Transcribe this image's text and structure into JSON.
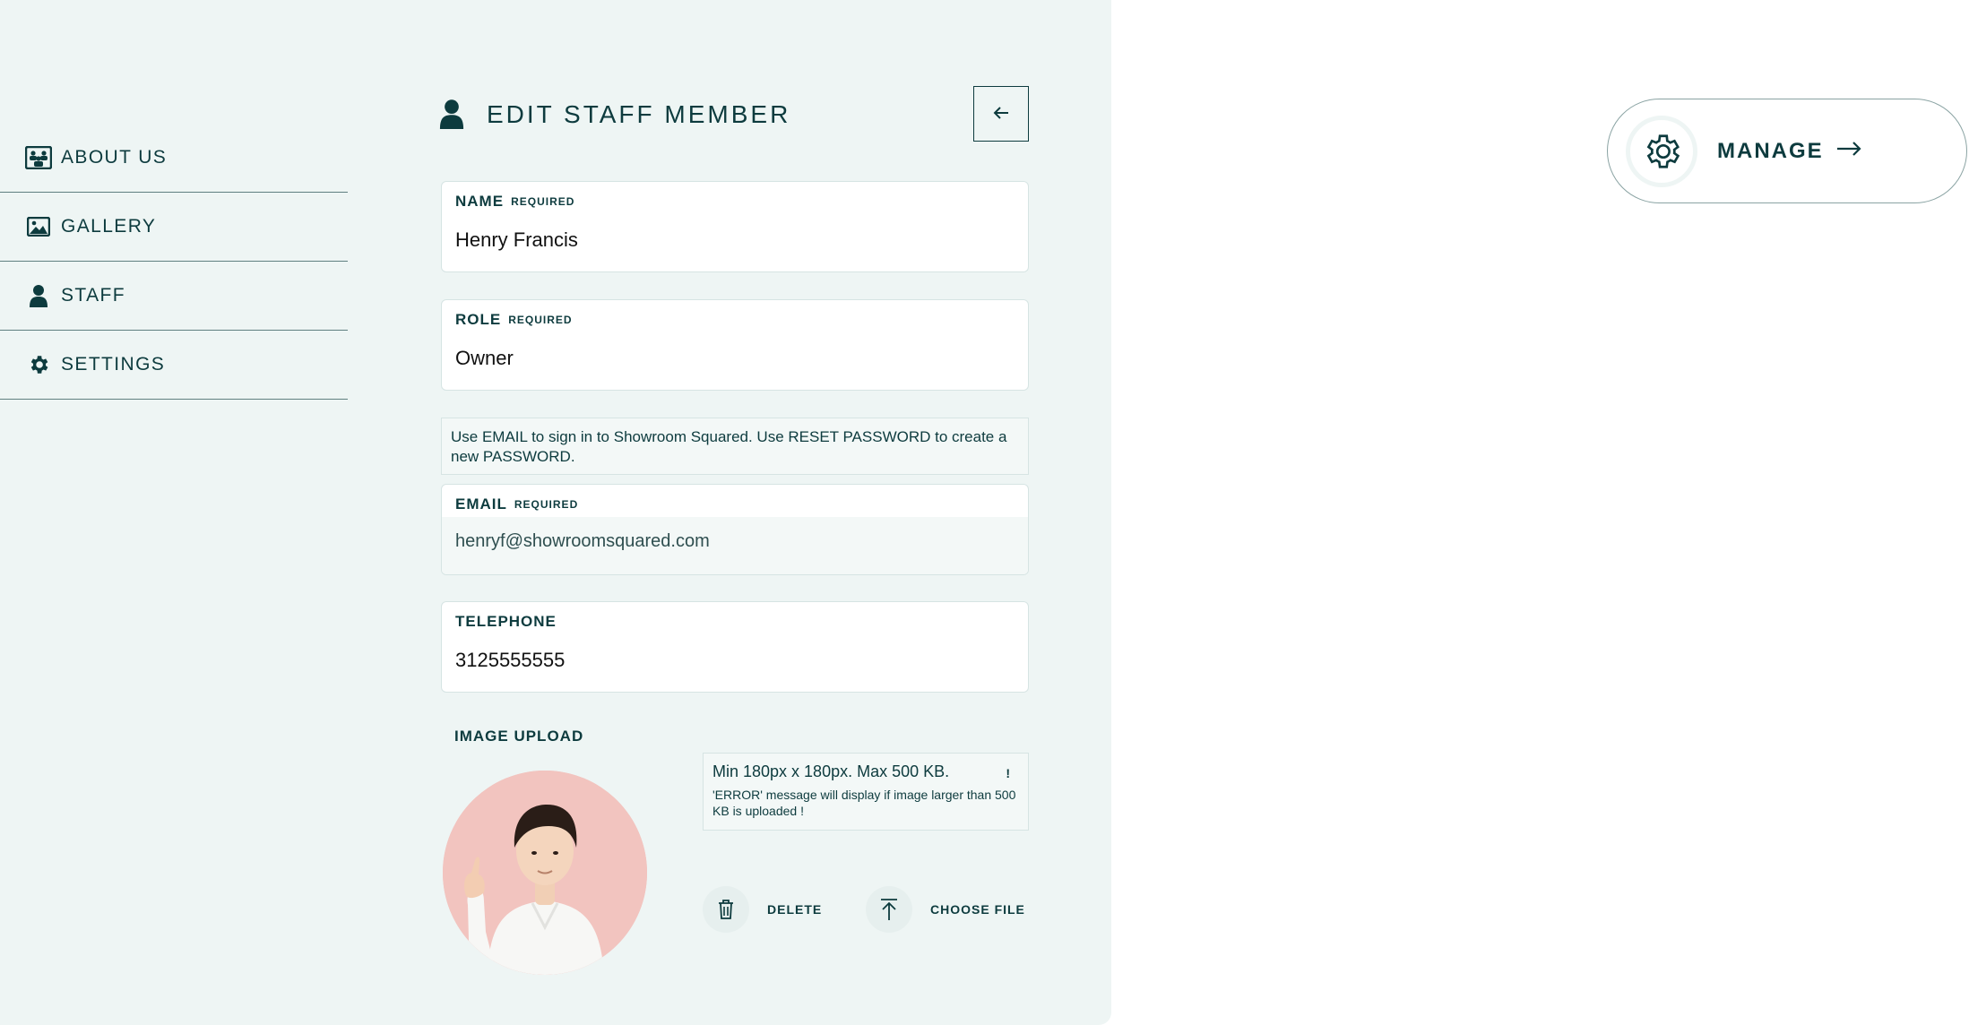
{
  "sidebar": {
    "items": [
      {
        "label": "ABOUT US",
        "icon": "team-icon"
      },
      {
        "label": "GALLERY",
        "icon": "image-icon"
      },
      {
        "label": "STAFF",
        "icon": "person-icon"
      },
      {
        "label": "SETTINGS",
        "icon": "gear-icon"
      }
    ]
  },
  "header": {
    "title": "EDIT STAFF MEMBER",
    "back_icon": "arrow-left-icon"
  },
  "form": {
    "name": {
      "label": "NAME",
      "required": "REQUIRED",
      "value": "Henry Francis"
    },
    "role": {
      "label": "ROLE",
      "required": "REQUIRED",
      "value": "Owner"
    },
    "info_text": "Use EMAIL to sign in to Showroom Squared. Use RESET PASSWORD to create a new PASSWORD.",
    "email": {
      "label": "EMAIL",
      "required": "REQUIRED",
      "value": "henryf@showroomsquared.com"
    },
    "telephone": {
      "label": "TELEPHONE",
      "value": "3125555555"
    }
  },
  "upload": {
    "title": "IMAGE UPLOAD",
    "note_main": "Min 180px x 180px. Max 500 KB.",
    "note_mark": "!",
    "note_detail": "'ERROR' message will display if image larger than 500 KB is uploaded !",
    "delete_label": "DELETE",
    "choose_label": "CHOOSE FILE"
  },
  "manage": {
    "label": "MANAGE"
  },
  "colors": {
    "panel_bg": "#eef5f4",
    "text": "#0d3b3e",
    "border": "#d6e4e3"
  }
}
